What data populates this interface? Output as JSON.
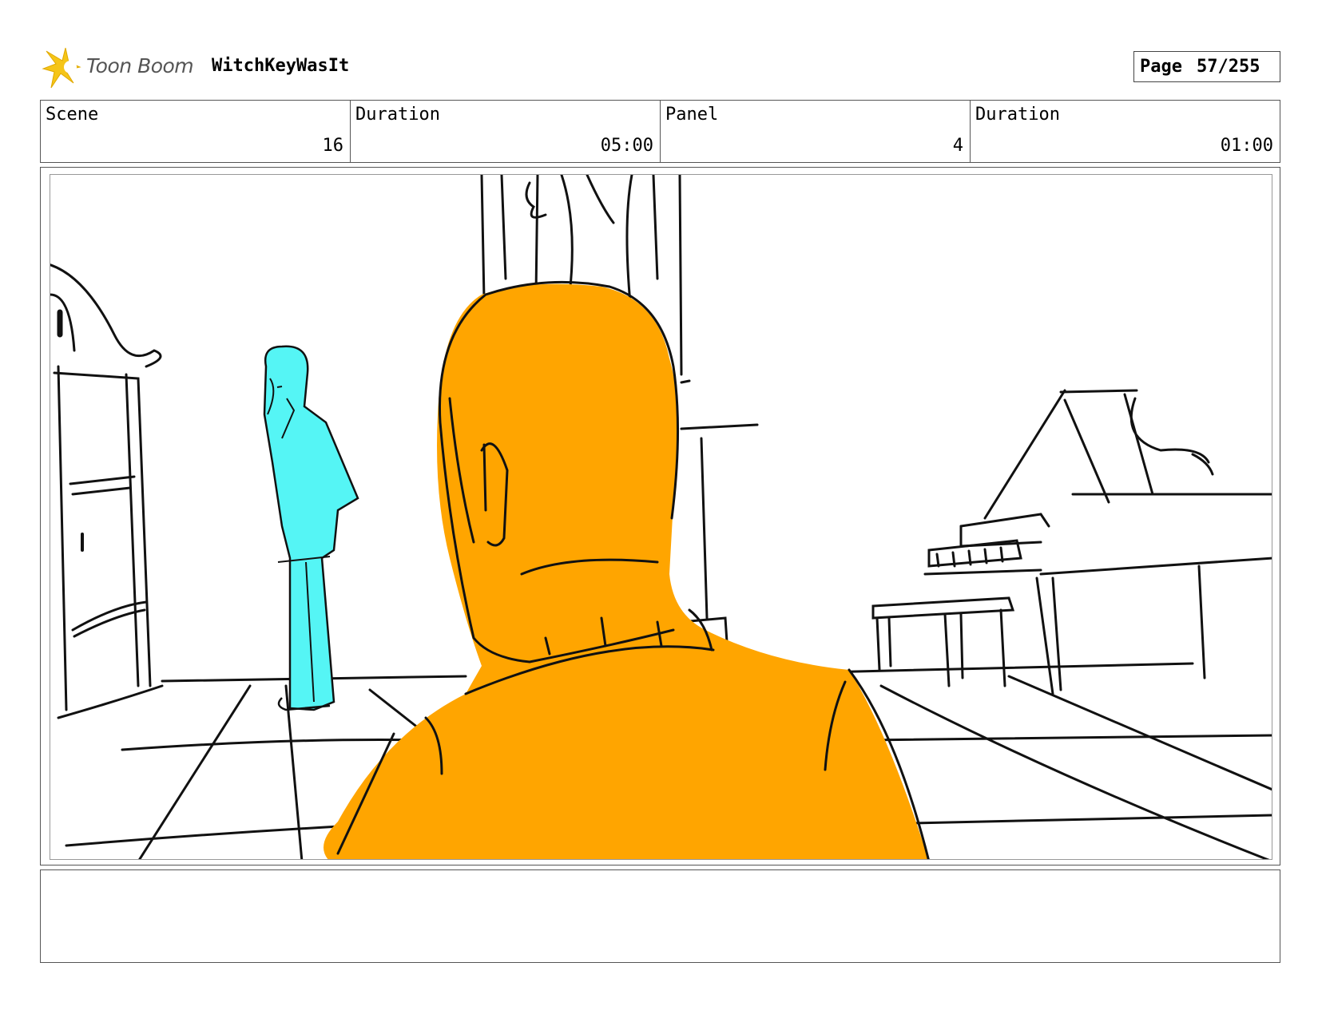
{
  "header": {
    "brand": "Toon Boom",
    "project_title": "WitchKeyWasIt",
    "page_label": "Page",
    "page_value": "57/255"
  },
  "info": {
    "scene_label": "Scene",
    "scene_value": "16",
    "scene_duration_label": "Duration",
    "scene_duration_value": "05:00",
    "panel_label": "Panel",
    "panel_value": "4",
    "panel_duration_label": "Duration",
    "panel_duration_value": "01:00"
  },
  "colors": {
    "foreground_character": "#FFA500",
    "background_character": "#55F5F5",
    "logo_star": "#F5C518"
  },
  "notes": ""
}
